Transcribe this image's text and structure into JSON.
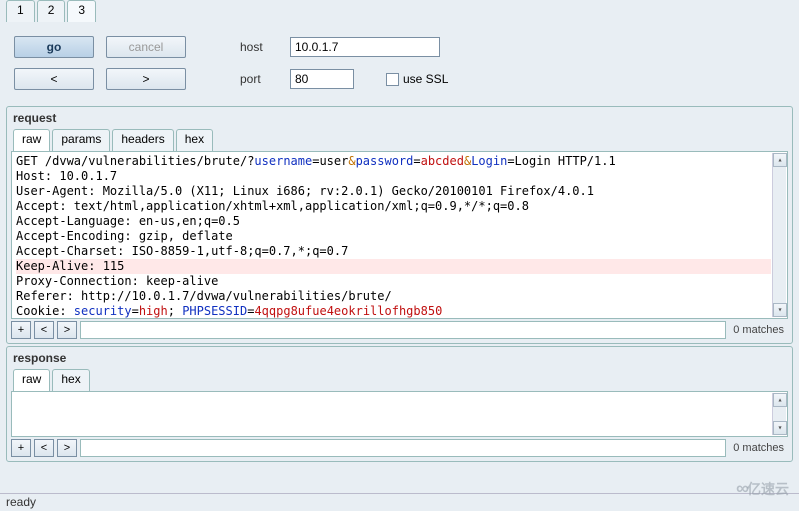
{
  "top_tabs": [
    "1",
    "2",
    "3"
  ],
  "active_top_tab": 2,
  "toolbar": {
    "go": "go",
    "cancel": "cancel",
    "prev": "<",
    "next": ">",
    "host_label": "host",
    "host_value": "10.0.1.7",
    "port_label": "port",
    "port_value": "80",
    "ssl_label": "use SSL",
    "ssl_checked": false
  },
  "request": {
    "title": "request",
    "tabs": [
      "raw",
      "params",
      "headers",
      "hex"
    ],
    "active_tab": 0,
    "lines": [
      {
        "segments": [
          {
            "t": "GET /dvwa/vulnerabilities/brute/?"
          },
          {
            "t": "username",
            "c": "blue"
          },
          {
            "t": "=user"
          },
          {
            "t": "&",
            "c": "orange"
          },
          {
            "t": "password",
            "c": "blue"
          },
          {
            "t": "="
          },
          {
            "t": "abcded",
            "c": "red"
          },
          {
            "t": "&",
            "c": "orange"
          },
          {
            "t": "Login",
            "c": "blue"
          },
          {
            "t": "=Login HTTP/1.1"
          }
        ]
      },
      {
        "segments": [
          {
            "t": "Host: 10.0.1.7"
          }
        ]
      },
      {
        "segments": [
          {
            "t": "User-Agent: Mozilla/5.0 (X11; Linux i686; rv:2.0.1) Gecko/20100101 Firefox/4.0.1"
          }
        ]
      },
      {
        "segments": [
          {
            "t": "Accept: text/html,application/xhtml+xml,application/xml;q=0.9,*/*;q=0.8"
          }
        ]
      },
      {
        "segments": [
          {
            "t": "Accept-Language: en-us,en;q=0.5"
          }
        ]
      },
      {
        "segments": [
          {
            "t": "Accept-Encoding: gzip, deflate"
          }
        ]
      },
      {
        "segments": [
          {
            "t": "Accept-Charset: ISO-8859-1,utf-8;q=0.7,*;q=0.7"
          }
        ]
      },
      {
        "segments": [
          {
            "t": "Keep-Alive: 115"
          }
        ],
        "hl": true
      },
      {
        "segments": [
          {
            "t": "Proxy-Connection: keep-alive"
          }
        ]
      },
      {
        "segments": [
          {
            "t": "Referer: http://10.0.1.7/dvwa/vulnerabilities/brute/"
          }
        ]
      },
      {
        "segments": [
          {
            "t": "Cookie: "
          },
          {
            "t": "security",
            "c": "blue"
          },
          {
            "t": "="
          },
          {
            "t": "high",
            "c": "red"
          },
          {
            "t": "; "
          },
          {
            "t": "PHPSESSID",
            "c": "blue"
          },
          {
            "t": "="
          },
          {
            "t": "4qqpg8ufue4eokrillofhgb850",
            "c": "red"
          }
        ]
      }
    ],
    "matches": "0 matches",
    "btns": {
      "plus": "+",
      "lt": "<",
      "gt": ">"
    }
  },
  "response": {
    "title": "response",
    "tabs": [
      "raw",
      "hex"
    ],
    "active_tab": 0,
    "content": "",
    "matches": "0 matches",
    "btns": {
      "plus": "+",
      "lt": "<",
      "gt": ">"
    }
  },
  "status": "ready",
  "watermark": "亿速云"
}
